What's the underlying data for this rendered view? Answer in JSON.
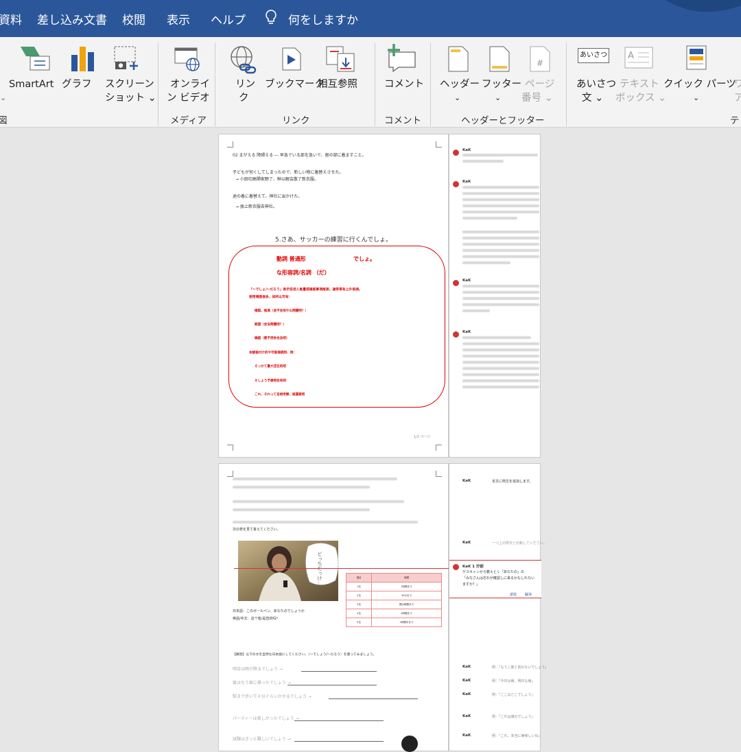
{
  "menu": {
    "tabs": [
      "資料",
      "差し込み文書",
      "校閲",
      "表示",
      "ヘルプ"
    ],
    "tell_me": "何をしますか"
  },
  "ribbon": {
    "buttons": {
      "smartart": "SmartArt",
      "chart": "グラフ",
      "screenshot_1": "スクリーン",
      "screenshot_2": "ショット ⌄",
      "online_video_1": "オンライ",
      "online_video_2": "ン ビデオ",
      "link_1": "リン",
      "link_2": "ク",
      "bookmark": "ブックマーク",
      "cross_ref": "相互参照",
      "comment": "コメント",
      "header": "ヘッダー",
      "footer": "フッター",
      "page_number_1": "ページ",
      "page_number_2": "番号 ⌄",
      "greeting_1": "あいさつ",
      "greeting_2": "文 ⌄",
      "textbox_1": "テキスト",
      "textbox_2": "ボックス ⌄",
      "quick_parts": "クイック パーツ",
      "wordart_1": "ワ",
      "wordart_2": "ア",
      "chevron": "⌄",
      "greeting_icon": "あいさつ"
    },
    "groups": {
      "media": "メディア",
      "links": "リンク",
      "comments": "コメント",
      "header_footer": "ヘッダーとフッター",
      "text": "テ",
      "left_cut": "図"
    }
  },
  "page1": {
    "heading_line": "02 まがえる 障碍える ― 早急でいる部を急いで、留の部に着ますこと。",
    "line2": "子どもが何くしてしまったので、新しい物に着替えさせた。",
    "line3": "→ 小田切高関家野了、种以解会散了新衣服。",
    "line4": "途の着に着替えて、神社に出かけた。",
    "line5": "→ 換上新衣服去神社。",
    "title": "5.さあ、サッカーの練習に行くんでしょ。",
    "box_line1a": "動詞  普通形",
    "box_line1b": "でしょ。",
    "box_line2": "な形容詞/名詞 （だ）",
    "box_line3": "「～でしょ/～だろう」表示说话人推量或確認事項推測，通常帯有上升语调。",
    "box_line4": "使用場面很多，如所以可有：",
    "bullets_a": [
      "確認、推測（会不会有什么問題吧？）",
      "期望（会没問題吧？）",
      "确認（要不然你也去吧）"
    ],
    "box_mid": "本語後付け的や可能接続用、例：",
    "bullets_b": [
      "そっかて最大还在的吧",
      "そしょう予想吧会有吧",
      "これ、それって言相考察、就還要吧"
    ],
    "page_num": "1/2 ページ"
  },
  "comments1": [
    {
      "name": "KaK",
      "text": "全体の部分に修正すべき点があります。"
    },
    {
      "name": "KaK",
      "text": "中級の文法の表現について、例文の追加を提案します。"
    },
    {
      "name": "KaK",
      "text": "「ーでしょう」のニュアンスについて説明を追加してください。"
    },
    {
      "name": "KaK",
      "text": "【文法補足・表現確認】「ーでしょう/ーだろう」は、推測や確認を表します。"
    }
  ],
  "page2": {
    "line1": "会話文の内容を確認してください。",
    "line2": "下線部の言葉を使って文を作りましょう。",
    "line3": "例文を参考にして書いてください。",
    "line4": "質問にはっきり答えましょう。",
    "line5": "次の表を見て答えてください。",
    "line6": "友達と話してみましょう。",
    "caption1": "日本語：このボールペン、あなたのでしょうか",
    "caption2": "英語/中文：这个笔/是您的吗？",
    "bubble": "どっちだっけ…",
    "task": "【練習】以下の文を自然な日本語にしてください。（～でしょう/～だろう）を使ってみましょう。",
    "exercises": [
      "明日は雨が降るでしょう → ",
      "彼はもう家に帰ったでしょう → ",
      "駅まで歩いて十分ぐらいかかるでしょう → ",
      "パーティーは楽しかったでしょう → ",
      "試験はきっと難しいでしょう → "
    ],
    "table_header": [
      "項目",
      "時間"
    ],
    "table_rows": [
      [
        "1位",
        "1時間まで"
      ],
      [
        "2位",
        "30分まで"
      ],
      [
        "3位",
        "提出時間まで"
      ],
      [
        "4位",
        "2時間まで"
      ],
      [
        "5位",
        "1時間半まで"
      ]
    ]
  },
  "comments2": {
    "c1_name": "KaK",
    "c1_text": "本文に例文を追加します。",
    "c2_name": "KaK",
    "c2_text": "一つ上の例文と比較してください。",
    "active_name": "KaK 1 分前",
    "active_line1": "ゲスキャンから教えとく「あなたの」の",
    "active_line2": "「みなさんは忘れが確認しに来るかもしれない",
    "active_line3": "ますか？」",
    "reply": "返信",
    "resolve": "解決",
    "list": [
      {
        "name": "KaK",
        "text": "例：「もう二度と買わないでしょう」"
      },
      {
        "name": "KaK",
        "text": "例：「今日は雨、明日も雨」"
      },
      {
        "name": "KaK",
        "text": "例：「ここはどこでしょう」"
      },
      {
        "name": "KaK",
        "text": "例：「これは誰のでしょう」"
      },
      {
        "name": "KaK",
        "text": "例：「これ、本当に美味しいね」"
      }
    ]
  },
  "colors": {
    "accent": "#2b579a",
    "red": "#e00000",
    "comment": "#d13438"
  }
}
